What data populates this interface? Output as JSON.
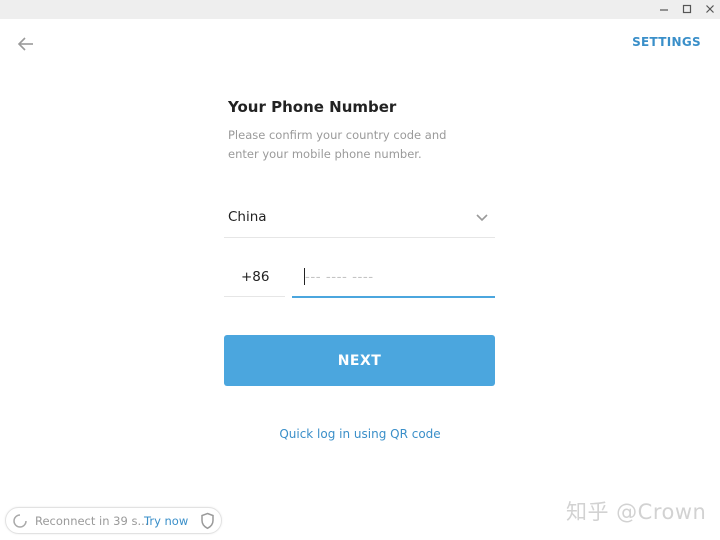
{
  "window": {
    "controls": {
      "minimize": "minimize-icon",
      "maximize": "maximize-icon",
      "close": "close-icon"
    }
  },
  "header": {
    "back_icon": "arrow-left-icon",
    "settings_label": "SETTINGS"
  },
  "login": {
    "title": "Your Phone Number",
    "description_line1": "Please confirm your country code and",
    "description_line2": "enter your mobile phone number.",
    "country": "China",
    "country_code": "+86",
    "phone_value": "",
    "phone_placeholder": "--- ---- ----",
    "next_label": "NEXT",
    "qr_link": "Quick log in using QR code"
  },
  "status": {
    "reconnect_text": "Reconnect in 39 s...",
    "try_now_label": "Try now",
    "proxy_icon": "shield-icon"
  },
  "watermark": "知乎 @Crown",
  "colors": {
    "accent": "#4ba6de",
    "link": "#3a8fc9",
    "muted_text": "#9a9a9a",
    "divider": "#e6e6e6"
  }
}
